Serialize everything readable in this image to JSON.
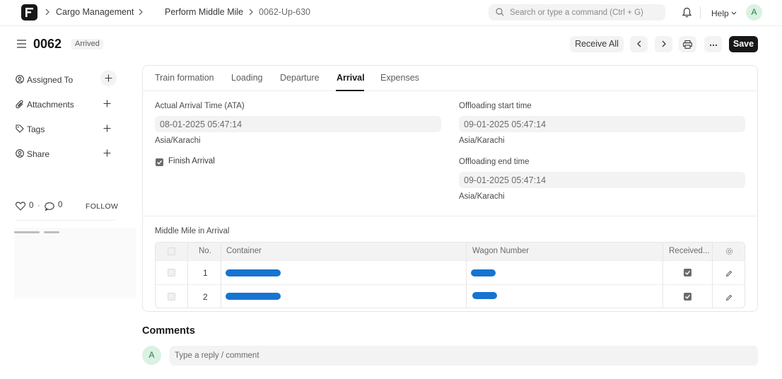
{
  "navbar": {
    "breadcrumbs": [
      "Cargo Management",
      "Perform Middle Mile",
      "0062-Up-630"
    ],
    "search_placeholder": "Search or type a command (Ctrl + G)",
    "help_label": "Help",
    "avatar_initial": "A"
  },
  "header": {
    "title": "0062",
    "status": "Arrived",
    "receive_all_label": "Receive All",
    "save_label": "Save"
  },
  "sidebar": {
    "items": [
      {
        "label": "Assigned To",
        "icon": "user-plus-icon"
      },
      {
        "label": "Attachments",
        "icon": "paperclip-icon"
      },
      {
        "label": "Tags",
        "icon": "tag-icon"
      },
      {
        "label": "Share",
        "icon": "share-user-icon"
      }
    ],
    "likes": "0",
    "comments": "0",
    "follow_label": "FOLLOW"
  },
  "tabs": [
    "Train formation",
    "Loading",
    "Departure",
    "Arrival",
    "Expenses"
  ],
  "active_tab": "Arrival",
  "arrival": {
    "ata_label": "Actual Arrival Time (ATA)",
    "ata_value": "08-01-2025 05:47:14",
    "ata_tz": "Asia/Karachi",
    "finish_label": "Finish Arrival",
    "finish_checked": true,
    "offload_start_label": "Offloading start time",
    "offload_start_value": "09-01-2025 05:47:14",
    "offload_start_tz": "Asia/Karachi",
    "offload_end_label": "Offloading end time",
    "offload_end_value": "09-01-2025 05:47:14",
    "offload_end_tz": "Asia/Karachi"
  },
  "table": {
    "title": "Middle Mile in Arrival",
    "columns": [
      "No.",
      "Container",
      "Wagon Number",
      "Received..."
    ],
    "rows": [
      {
        "no": "1",
        "received": true
      },
      {
        "no": "2",
        "received": true
      }
    ]
  },
  "comments": {
    "title": "Comments",
    "avatar_initial": "A",
    "placeholder": "Type a reply / comment"
  },
  "colors": {
    "primary": "#171717",
    "redaction": "#1774d1",
    "avatar_bg": "#d9f2e2"
  }
}
